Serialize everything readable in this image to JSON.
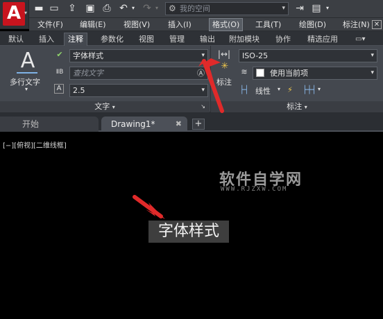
{
  "quick_access": {
    "workspace_placeholder": "我的空间"
  },
  "menu": {
    "items": [
      "文件(F)",
      "编辑(E)",
      "视图(V)",
      "插入(I)",
      "格式(O)",
      "工具(T)",
      "绘图(D)",
      "标注(N)"
    ],
    "active": "格式(O)"
  },
  "ribbon": {
    "tabs": [
      "默认",
      "插入",
      "注释",
      "参数化",
      "视图",
      "管理",
      "输出",
      "附加模块",
      "协作",
      "精选应用"
    ],
    "active_tab": "注释",
    "text_panel": {
      "title": "文字",
      "multiline_label": "多行文字",
      "font_style": "字体样式",
      "find_placeholder": "查找文字",
      "height": "2.5"
    },
    "dim_panel": {
      "title": "标注",
      "dim_label": "标注",
      "dim_style": "ISO-25",
      "layer": "使用当前项",
      "linear": "线性"
    }
  },
  "doc_tabs": {
    "start": "开始",
    "drawing": "Drawing1*"
  },
  "viewport": {
    "label": "[−][俯视][二维线框]",
    "watermark": "软件自学网",
    "watermark_url": "WWW.RJZXW.COM",
    "text_object": "字体样式"
  },
  "colors": {
    "accent_red": "#e02a2a",
    "logo_red": "#c8141e"
  }
}
